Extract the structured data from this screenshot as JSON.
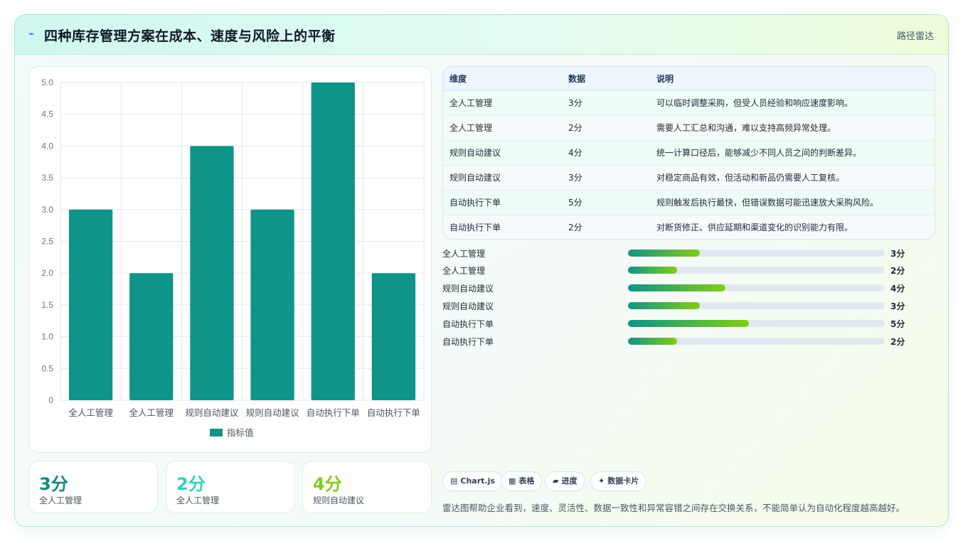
{
  "header": {
    "icon": "pulse-icon",
    "title": "四种库存管理方案在成本、速度与风险上的平衡",
    "tag": "路径雷达"
  },
  "chart_data": {
    "type": "bar",
    "categories": [
      "全人工管理",
      "全人工管理",
      "规则自动建议",
      "规则自动建议",
      "自动执行下单",
      "自动执行下单"
    ],
    "series": [
      {
        "name": "指标值",
        "values": [
          3,
          2,
          4,
          3,
          5,
          2
        ],
        "color": "#0f9488"
      }
    ],
    "ylim": [
      0,
      5
    ],
    "yticks": [
      "0",
      "0.5",
      "1.0",
      "1.5",
      "2.0",
      "2.5",
      "3.0",
      "3.5",
      "4.0",
      "4.5",
      "5.0"
    ],
    "grid": true,
    "legend_position": "bottom"
  },
  "kpis": [
    {
      "value": "3分",
      "label": "全人工管理",
      "color": "#0f8a7e"
    },
    {
      "value": "2分",
      "label": "全人工管理",
      "color": "#2dd4bf"
    },
    {
      "value": "4分",
      "label": "规则自动建议",
      "color": "#84cc16"
    }
  ],
  "table": {
    "headers": [
      "维度",
      "数据",
      "说明"
    ],
    "rows": [
      [
        "全人工管理",
        "3分",
        "可以临时调整采购，但受人员经验和响应速度影响。"
      ],
      [
        "全人工管理",
        "2分",
        "需要人工汇总和沟通，难以支持高频异常处理。"
      ],
      [
        "规则自动建议",
        "4分",
        "统一计算口径后，能够减少不同人员之间的判断差异。"
      ],
      [
        "规则自动建议",
        "3分",
        "对稳定商品有效，但活动和新品仍需要人工复核。"
      ],
      [
        "自动执行下单",
        "5分",
        "规则触发后执行最快，但错误数据可能迅速放大采购风险。"
      ],
      [
        "自动执行下单",
        "2分",
        "对断货修正、供应延期和渠道变化的识别能力有限。"
      ]
    ]
  },
  "progress": [
    {
      "label": "全人工管理",
      "value": "3分",
      "fraction": 0.28
    },
    {
      "label": "全人工管理",
      "value": "2分",
      "fraction": 0.19
    },
    {
      "label": "规则自动建议",
      "value": "4分",
      "fraction": 0.38
    },
    {
      "label": "规则自动建议",
      "value": "3分",
      "fraction": 0.28
    },
    {
      "label": "自动执行下单",
      "value": "5分",
      "fraction": 0.47
    },
    {
      "label": "自动执行下单",
      "value": "2分",
      "fraction": 0.19
    }
  ],
  "pills": [
    {
      "icon": "chart-icon",
      "glyph": "▤",
      "label": "Chart.js"
    },
    {
      "icon": "table-icon",
      "glyph": "▦",
      "label": "表格"
    },
    {
      "icon": "progress-icon",
      "glyph": "▰",
      "label": "进度"
    },
    {
      "icon": "sparkle-icon",
      "glyph": "✦",
      "label": "数据卡片"
    }
  ],
  "footer_note": "雷达图帮助企业看到，速度、灵活性、数据一致性和异常容错之间存在交换关系，不能简单认为自动化程度越高越好。"
}
